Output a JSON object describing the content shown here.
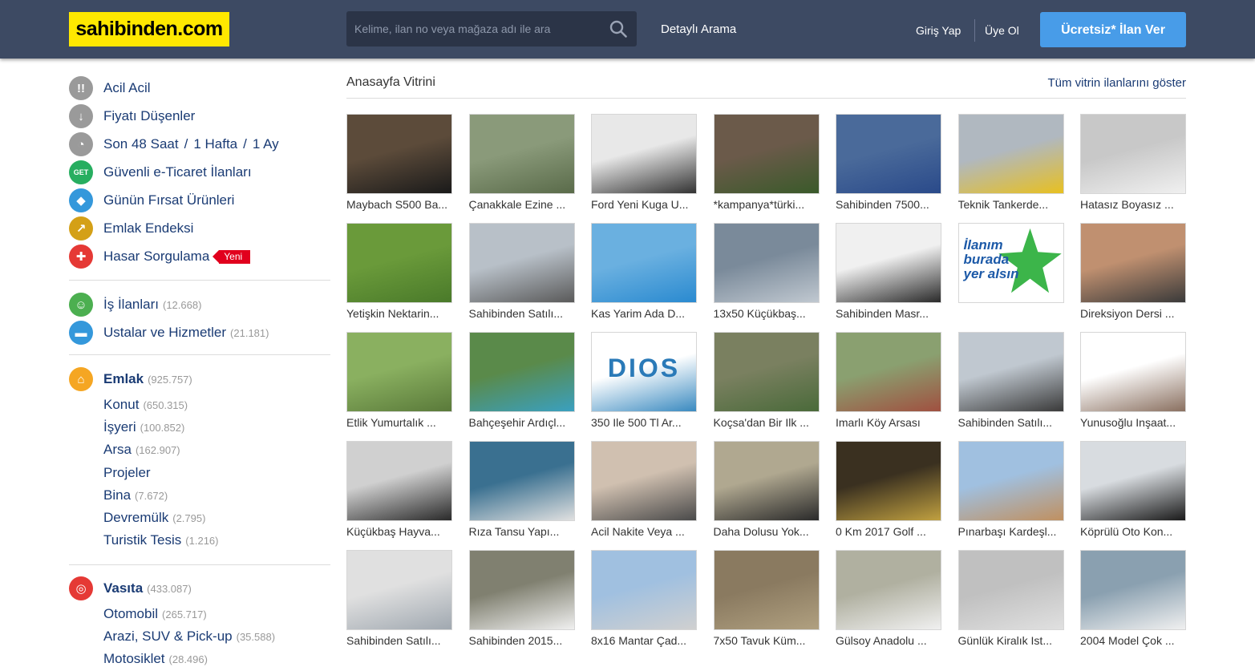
{
  "header": {
    "logo": "sahibinden.com",
    "search_placeholder": "Kelime, ilan no veya mağaza adı ile ara",
    "advanced_search": "Detaylı Arama",
    "login": "Giriş Yap",
    "register": "Üye Ol",
    "post_ad": "Ücretsiz* İlan Ver"
  },
  "sidebar": {
    "quick": [
      {
        "label": "Acil Acil",
        "icon": "exclamation-icon",
        "color": "#9a9a9a",
        "glyph": "!!"
      },
      {
        "label": "Fiyatı Düşenler",
        "icon": "arrow-down-icon",
        "color": "#9a9a9a",
        "glyph": "↓"
      },
      {
        "label": "Son 48 Saat",
        "extra1": "1 Hafta",
        "extra2": "1 Ay",
        "icon": "clock-icon",
        "color": "#9a9a9a",
        "glyph": "◔"
      },
      {
        "label": "Güvenli e-Ticaret İlanları",
        "icon": "get-icon",
        "color": "#27ae60",
        "glyph": "GET"
      },
      {
        "label": "Günün Fırsat Ürünleri",
        "icon": "tag-icon",
        "color": "#3498db",
        "glyph": "◆"
      },
      {
        "label": "Emlak Endeksi",
        "icon": "chart-icon",
        "color": "#d4a017",
        "glyph": "↗"
      },
      {
        "label": "Hasar Sorgulama",
        "icon": "car-damage-icon",
        "color": "#e53935",
        "glyph": "✚",
        "badge": "Yeni"
      }
    ],
    "services": [
      {
        "label": "İş İlanları",
        "count": "(12.668)",
        "icon": "jobs-icon",
        "color": "#4caf50",
        "glyph": "☺"
      },
      {
        "label": "Ustalar ve Hizmetler",
        "count": "(21.181)",
        "icon": "paint-roller-icon",
        "color": "#3498db",
        "glyph": "▬"
      }
    ],
    "emlak": {
      "label": "Emlak",
      "count": "(925.757)",
      "icon": "house-icon",
      "color": "#f5a623",
      "glyph": "⌂",
      "subs": [
        {
          "label": "Konut",
          "count": "(650.315)"
        },
        {
          "label": "İşyeri",
          "count": "(100.852)"
        },
        {
          "label": "Arsa",
          "count": "(162.907)"
        },
        {
          "label": "Projeler",
          "count": ""
        },
        {
          "label": "Bina",
          "count": "(7.672)"
        },
        {
          "label": "Devremülk",
          "count": "(2.795)"
        },
        {
          "label": "Turistik Tesis",
          "count": "(1.216)"
        }
      ]
    },
    "vasita": {
      "label": "Vasıta",
      "count": "(433.087)",
      "icon": "steering-wheel-icon",
      "color": "#e53935",
      "glyph": "◎",
      "subs": [
        {
          "label": "Otomobil",
          "count": "(265.717)"
        },
        {
          "label": "Arazi, SUV & Pick-up",
          "count": "(35.588)"
        },
        {
          "label": "Motosiklet",
          "count": "(28.496)"
        }
      ]
    }
  },
  "main": {
    "title": "Anasayfa Vitrini",
    "show_all": "Tüm vitrin ilanlarını göster",
    "listings": [
      {
        "title": "Maybach S500 Ba...",
        "colors": [
          "#5c4b3a",
          "#1a1a1a"
        ]
      },
      {
        "title": "Çanakkale Ezine ...",
        "colors": [
          "#8a9a7a",
          "#5a6b4a"
        ]
      },
      {
        "title": "Ford Yeni Kuga U...",
        "colors": [
          "#e8e8e8",
          "#333333"
        ]
      },
      {
        "title": "*kampanya*türki...",
        "colors": [
          "#6b5a4a",
          "#3a5a2a"
        ]
      },
      {
        "title": "Sahibinden 7500...",
        "colors": [
          "#4a6a9a",
          "#2a4a8a"
        ]
      },
      {
        "title": "Teknik Tankerde...",
        "colors": [
          "#b0b8c0",
          "#e8c020"
        ]
      },
      {
        "title": "Hatasız Boyasız ...",
        "colors": [
          "#c8c8c8",
          "#f0f0f0"
        ]
      },
      {
        "title": "Yetişkin Nektarin...",
        "colors": [
          "#6a9a3a",
          "#4a7a2a"
        ]
      },
      {
        "title": "Sahibinden Satılı...",
        "colors": [
          "#b8c0c8",
          "#5a5a5a"
        ]
      },
      {
        "title": "Kas Yarim Ada D...",
        "colors": [
          "#6ab0e0",
          "#2a8ad0"
        ]
      },
      {
        "title": "13x50 Küçükbaş...",
        "colors": [
          "#7a8a9a",
          "#c0c8d0"
        ]
      },
      {
        "title": "Sahibinden Masr...",
        "colors": [
          "#f0f0f0",
          "#2a2a2a"
        ]
      },
      {
        "title": "",
        "colors": [
          "#ffffff",
          "#ffffff"
        ],
        "promo": "İlanım burada yer alsın"
      },
      {
        "title": "Direksiyon Dersi ...",
        "colors": [
          "#c09070",
          "#3a3a3a"
        ]
      },
      {
        "title": "Etlik Yumurtalık ...",
        "colors": [
          "#8ab060",
          "#5a7a3a"
        ]
      },
      {
        "title": "Bahçeşehir Ardıçl...",
        "colors": [
          "#5a8a4a",
          "#3aa0c0"
        ]
      },
      {
        "title": "350 Ile 500 Tl Ar...",
        "colors": [
          "#ffffff",
          "#3a8ac0"
        ],
        "logo": "DIOS"
      },
      {
        "title": "Koçsa'dan Bir Ilk ...",
        "colors": [
          "#7a8060",
          "#4a6a3a"
        ]
      },
      {
        "title": "Imarlı Köy Arsası",
        "colors": [
          "#8aa070",
          "#a05040"
        ]
      },
      {
        "title": "Sahibinden Satılı...",
        "colors": [
          "#c0c8d0",
          "#3a3a3a"
        ]
      },
      {
        "title": "Yunusoğlu Inşaat...",
        "colors": [
          "#ffffff",
          "#8a7060"
        ]
      },
      {
        "title": "Küçükbaş Hayva...",
        "colors": [
          "#d0d0d0",
          "#2a2a2a"
        ]
      },
      {
        "title": "Rıza Tansu Yapı...",
        "colors": [
          "#3a7090",
          "#e0e0e0"
        ]
      },
      {
        "title": "Acil Nakite Veya ...",
        "colors": [
          "#d0c0b0",
          "#4a4a4a"
        ]
      },
      {
        "title": "Daha Dolusu Yok...",
        "colors": [
          "#b0a890",
          "#2a2a2a"
        ]
      },
      {
        "title": "0 Km 2017 Golf ...",
        "colors": [
          "#3a3020",
          "#c0a040"
        ]
      },
      {
        "title": "Pınarbaşı Kardeşl...",
        "colors": [
          "#a0c0e0",
          "#c09060"
        ]
      },
      {
        "title": "Köprülü Oto Kon...",
        "colors": [
          "#d8dce0",
          "#1a1a1a"
        ]
      },
      {
        "title": "Sahibinden Satılı...",
        "colors": [
          "#e0e0e0",
          "#a0a8b0"
        ]
      },
      {
        "title": "Sahibinden 2015...",
        "colors": [
          "#808070",
          "#f0f0f0"
        ]
      },
      {
        "title": "8x16 Mantar Çad...",
        "colors": [
          "#a0c0e0",
          "#d0d0d0"
        ]
      },
      {
        "title": "7x50 Tavuk Küm...",
        "colors": [
          "#8a7a60",
          "#b0a080"
        ]
      },
      {
        "title": "Gülsoy Anadolu ...",
        "colors": [
          "#b0b0a0",
          "#f0f0f0"
        ]
      },
      {
        "title": "Günlük Kiralık Ist...",
        "colors": [
          "#c0c0c0",
          "#e0e0e0"
        ]
      },
      {
        "title": "2004 Model Çok ...",
        "colors": [
          "#8aa0b0",
          "#f0f0f0"
        ]
      }
    ]
  }
}
